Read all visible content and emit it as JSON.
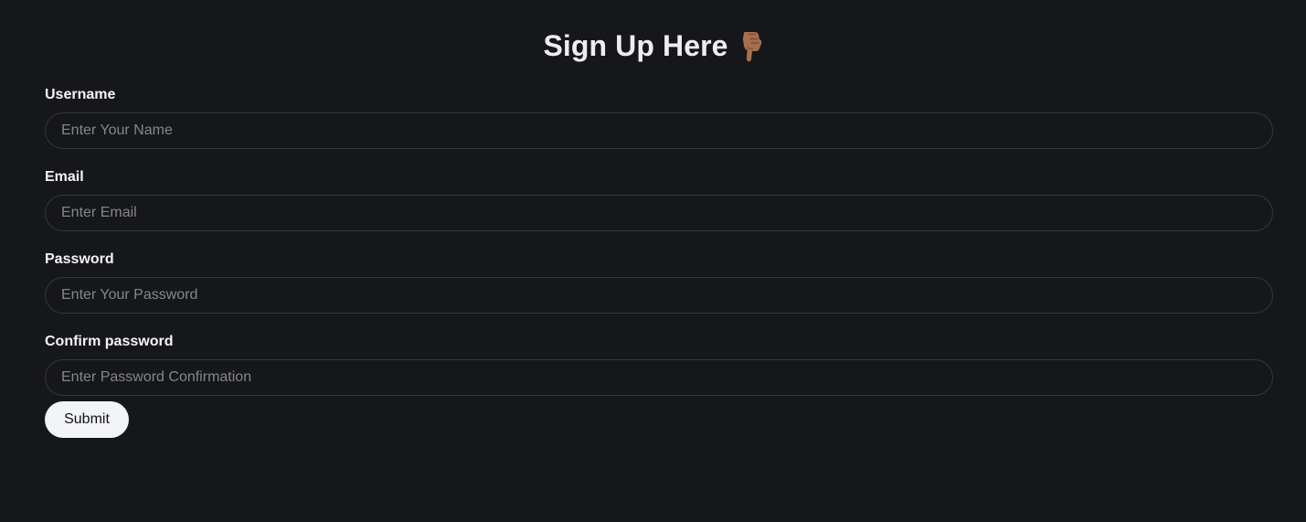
{
  "header": {
    "title": "Sign Up Here",
    "icon": "pointing-down-hand-icon"
  },
  "form": {
    "fields": [
      {
        "label": "Username",
        "placeholder": "Enter Your Name",
        "value": ""
      },
      {
        "label": "Email",
        "placeholder": "Enter Email",
        "value": ""
      },
      {
        "label": "Password",
        "placeholder": "Enter Your Password",
        "value": ""
      },
      {
        "label": "Confirm password",
        "placeholder": "Enter Password Confirmation",
        "value": ""
      }
    ],
    "submit_label": "Submit"
  },
  "colors": {
    "background": "#16171b",
    "text": "#f4f4f5",
    "input_border": "#35363c",
    "placeholder": "#85868c",
    "button_background": "#f3f4f6",
    "button_text": "#111214",
    "hand_icon": "#a76f4c"
  }
}
